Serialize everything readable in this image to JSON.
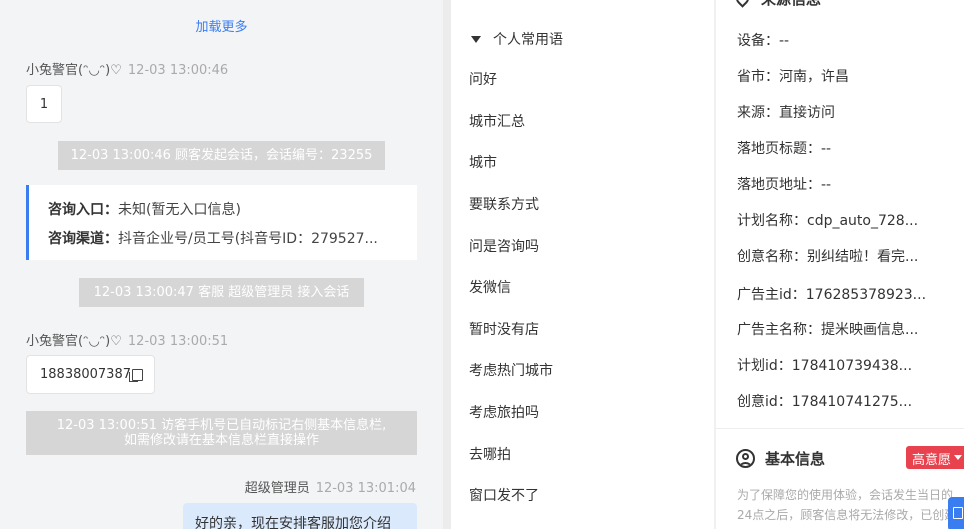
{
  "chat": {
    "load_more": "加载更多",
    "msg1": {
      "sender": "小兔警官(ᵔ◡ᵔ)♡",
      "time": "12-03 13:00:46",
      "text": "1"
    },
    "sys1": "12-03 13:00:46 顾客发起会话，会话编号：23255",
    "entry": {
      "label1": "咨询入口：",
      "value1": "未知(暂无入口信息)",
      "label2": "咨询渠道：",
      "value2": "抖音企业号/员工号(抖音号ID：279527..."
    },
    "sys2": "12-03 13:00:47 客服 超级管理员 接入会话",
    "msg2": {
      "sender": "小兔警官(ᵔ◡ᵔ)♡",
      "time": "12-03 13:00:51",
      "text": "18838007387"
    },
    "sys3_line1": "12-03 13:00:51 访客手机号已自动标记右侧基本信息栏,",
    "sys3_line2": "如需修改请在基本信息栏直接操作",
    "agent": {
      "sender": "超级管理员",
      "time": "12-03 13:01:04",
      "text": "好的亲，现在安排客服加您介绍"
    }
  },
  "phrases": {
    "header": "个人常用语",
    "items": [
      "问好",
      "城市汇总",
      "城市",
      "要联系方式",
      "问是咨询吗",
      "发微信",
      "暂时没有店",
      "考虑热门城市",
      "考虑旅拍吗",
      "去哪拍",
      "窗口发不了"
    ]
  },
  "source": {
    "title": "来源信息",
    "rows": [
      "设备：--",
      "省市：河南，许昌",
      "来源：直接访问",
      "落地页标题：--",
      "落地页地址：--",
      "计划名称：cdp_auto_728...",
      "创意名称：别纠结啦！看完...",
      "广告主id：176285378923...",
      "广告主名称：提米映画信息...",
      "计划id：178410739438...",
      "创意id：178410741275..."
    ]
  },
  "basic": {
    "title": "基本信息",
    "intent": "高意愿",
    "notice": "为了保障您的使用体验，会话发生当日的24点之后，顾客信息将无法修改，已创建"
  },
  "colors": {
    "accent": "#3a7df0",
    "intent": "#e8424e",
    "agent_bubble": "#dbe9fd"
  }
}
